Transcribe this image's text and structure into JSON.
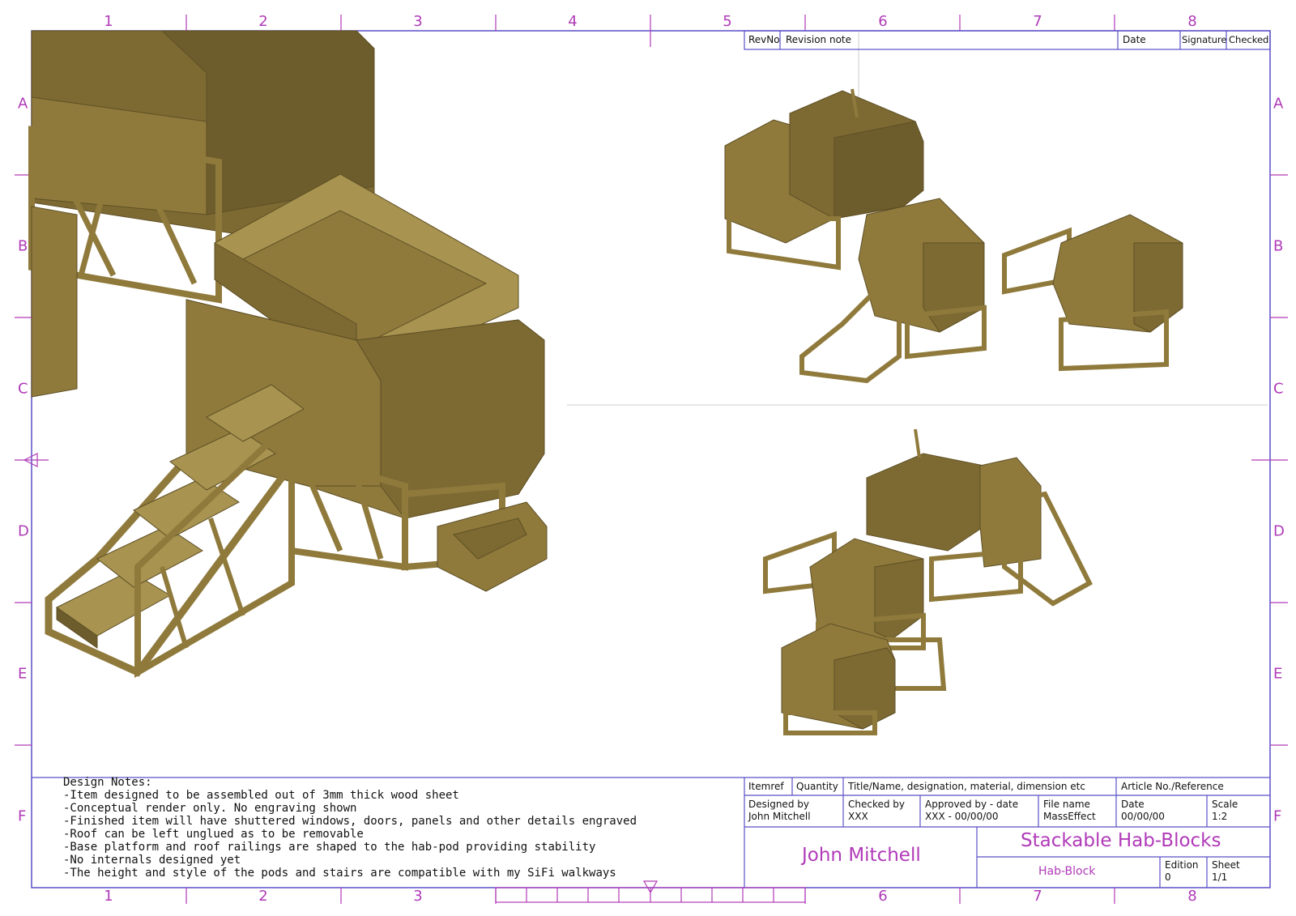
{
  "columns": [
    "1",
    "2",
    "3",
    "4",
    "5",
    "6",
    "7",
    "8"
  ],
  "rows": [
    "A",
    "B",
    "C",
    "D",
    "E",
    "F"
  ],
  "revision_table": {
    "rev_no": "RevNo",
    "revision_note": "Revision note",
    "date": "Date",
    "signature": "Signature",
    "checked": "Checked"
  },
  "design_notes": {
    "heading": "Design Notes:",
    "lines": [
      "-Item designed to be assembled out of 3mm thick wood sheet",
      "-Conceptual render only. No engraving shown",
      "-Finished item will have shuttered windows, doors, panels and other details engraved",
      "-Roof can be left unglued as to be removable",
      "-Base platform and roof railings are shaped to the hab-pod providing stability",
      "-No internals designed yet",
      "-The height and style of the pods and stairs are compatible with my SiFi walkways"
    ]
  },
  "title_block": {
    "itemref": "Itemref",
    "quantity": "Quantity",
    "title_header": "Title/Name, designation, material, dimension etc",
    "article_header": "Article No./Reference",
    "designed_by_label": "Designed by",
    "designed_by": "John Mitchell",
    "checked_by_label": "Checked by",
    "checked_by": "XXX",
    "approved_label": "Approved by - date",
    "approved": "XXX - 00/00/00",
    "file_name_label": "File name",
    "file_name": "MassEffect",
    "date_label": "Date",
    "date": "00/00/00",
    "scale_label": "Scale",
    "scale": "1:2",
    "author": "John Mitchell",
    "title": "Stackable Hab-Blocks",
    "subtitle": "Hab-Block",
    "edition_label": "Edition",
    "edition": "0",
    "sheet_label": "Sheet",
    "sheet": "1/1"
  },
  "colors": {
    "frame": "#5a4fc7",
    "ticks": "#b03ab8",
    "model_face": "#8f7a3c",
    "model_dark": "#6e5d2c",
    "model_light": "#a89450"
  }
}
